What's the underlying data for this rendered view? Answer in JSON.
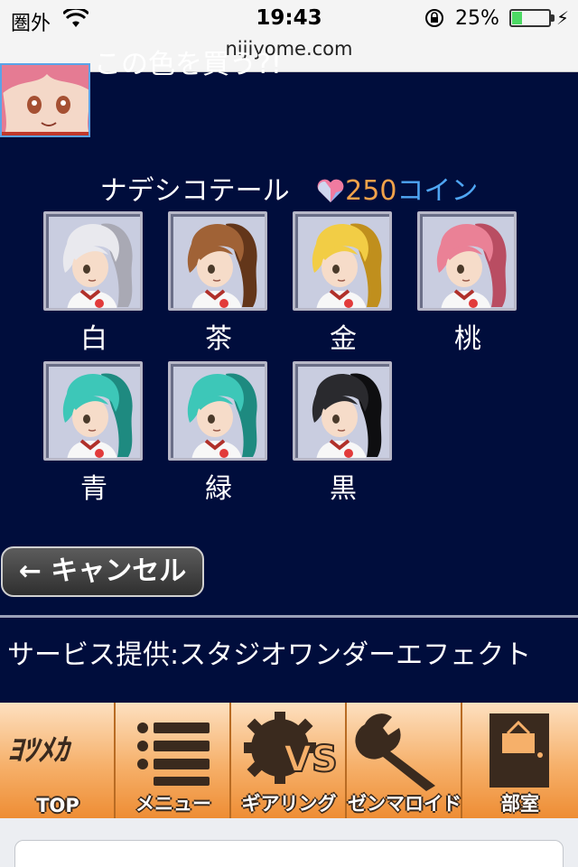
{
  "status_bar": {
    "carrier": "圏外",
    "time": "19:43",
    "battery_percent": "25%",
    "battery_level": 0.25,
    "url": "nijiyome.com"
  },
  "header": {
    "message": "この色を買う?!",
    "avatar_icon": "character-avatar"
  },
  "item": {
    "name": "ナデシコテール",
    "price": "250",
    "currency": "コイン",
    "coin_icon": "heart-coin-icon"
  },
  "colors": [
    {
      "label": "白",
      "hair": "#e9e9ee",
      "hair_dark": "#a9a9b4"
    },
    {
      "label": "茶",
      "hair": "#a06236",
      "hair_dark": "#63361a"
    },
    {
      "label": "金",
      "hair": "#f2cd45",
      "hair_dark": "#c08f1d"
    },
    {
      "label": "桃",
      "hair": "#ea8196",
      "hair_dark": "#b94d62"
    },
    {
      "label": "青",
      "hair": "#3dc7b8",
      "hair_dark": "#1e8a80"
    },
    {
      "label": "緑",
      "hair": "#3dc7b8",
      "hair_dark": "#1e8a80"
    },
    {
      "label": "黒",
      "hair": "#2a2a2e",
      "hair_dark": "#0e0e10"
    }
  ],
  "cancel": {
    "label": "← キャンセル"
  },
  "credit": "サービス提供:スタジオワンダーエフェクト",
  "nav": [
    {
      "label": "TOP",
      "icon": "logo-icon"
    },
    {
      "label": "メニュー",
      "icon": "menu-list-icon"
    },
    {
      "label": "ギアリング",
      "icon": "gear-vs-icon"
    },
    {
      "label": "ゼンマロイド",
      "icon": "wrench-icon"
    },
    {
      "label": "部室",
      "icon": "door-icon"
    }
  ]
}
